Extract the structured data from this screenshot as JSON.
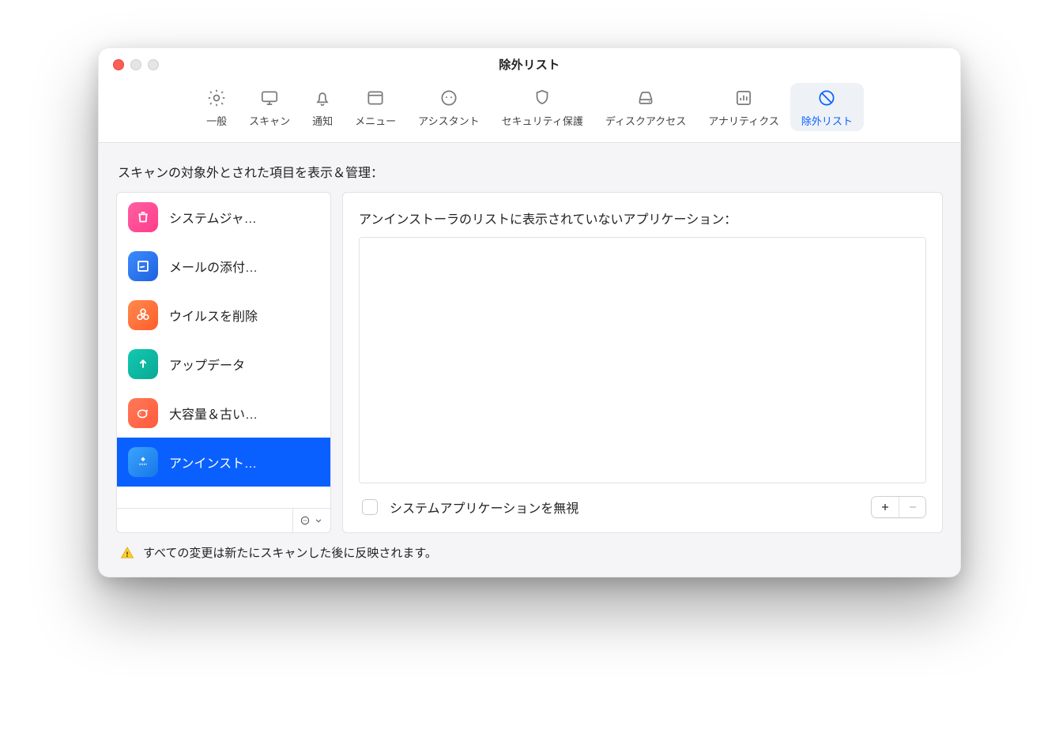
{
  "window": {
    "title": "除外リスト"
  },
  "toolbar": {
    "items": [
      {
        "id": "general",
        "label": "一般"
      },
      {
        "id": "scan",
        "label": "スキャン"
      },
      {
        "id": "notify",
        "label": "通知"
      },
      {
        "id": "menu",
        "label": "メニュー"
      },
      {
        "id": "assistant",
        "label": "アシスタント"
      },
      {
        "id": "security",
        "label": "セキュリティ保護"
      },
      {
        "id": "disk",
        "label": "ディスクアクセス"
      },
      {
        "id": "analytics",
        "label": "アナリティクス"
      },
      {
        "id": "ignore",
        "label": "除外リスト"
      }
    ],
    "active_id": "ignore"
  },
  "page": {
    "heading": "スキャンの対象外とされた項目を表示＆管理：",
    "notice": "すべての変更は新たにスキャンした後に反映されます。"
  },
  "sidebar": {
    "items": [
      {
        "id": "sysjunk",
        "label": "システムジャ…",
        "icon": "trash",
        "bg": "ic-pink"
      },
      {
        "id": "mail",
        "label": "メールの添付…",
        "icon": "stamp",
        "bg": "ic-blue"
      },
      {
        "id": "malware",
        "label": "ウイルスを削除",
        "icon": "biohazard",
        "bg": "ic-orange"
      },
      {
        "id": "updater",
        "label": "アップデータ",
        "icon": "arrow-up",
        "bg": "ic-teal"
      },
      {
        "id": "large-old",
        "label": "大容量＆古い…",
        "icon": "whale",
        "bg": "ic-coral"
      },
      {
        "id": "uninstaller",
        "label": "アンインスト…",
        "icon": "apps",
        "bg": "ic-apps"
      }
    ],
    "selected_id": "uninstaller",
    "filter_value": ""
  },
  "main": {
    "heading": "アンインストーラのリストに表示されていないアプリケーション：",
    "checkbox_label": "システムアプリケーションを無視",
    "checkbox_checked": false,
    "add_label": "+",
    "remove_label": "−"
  }
}
